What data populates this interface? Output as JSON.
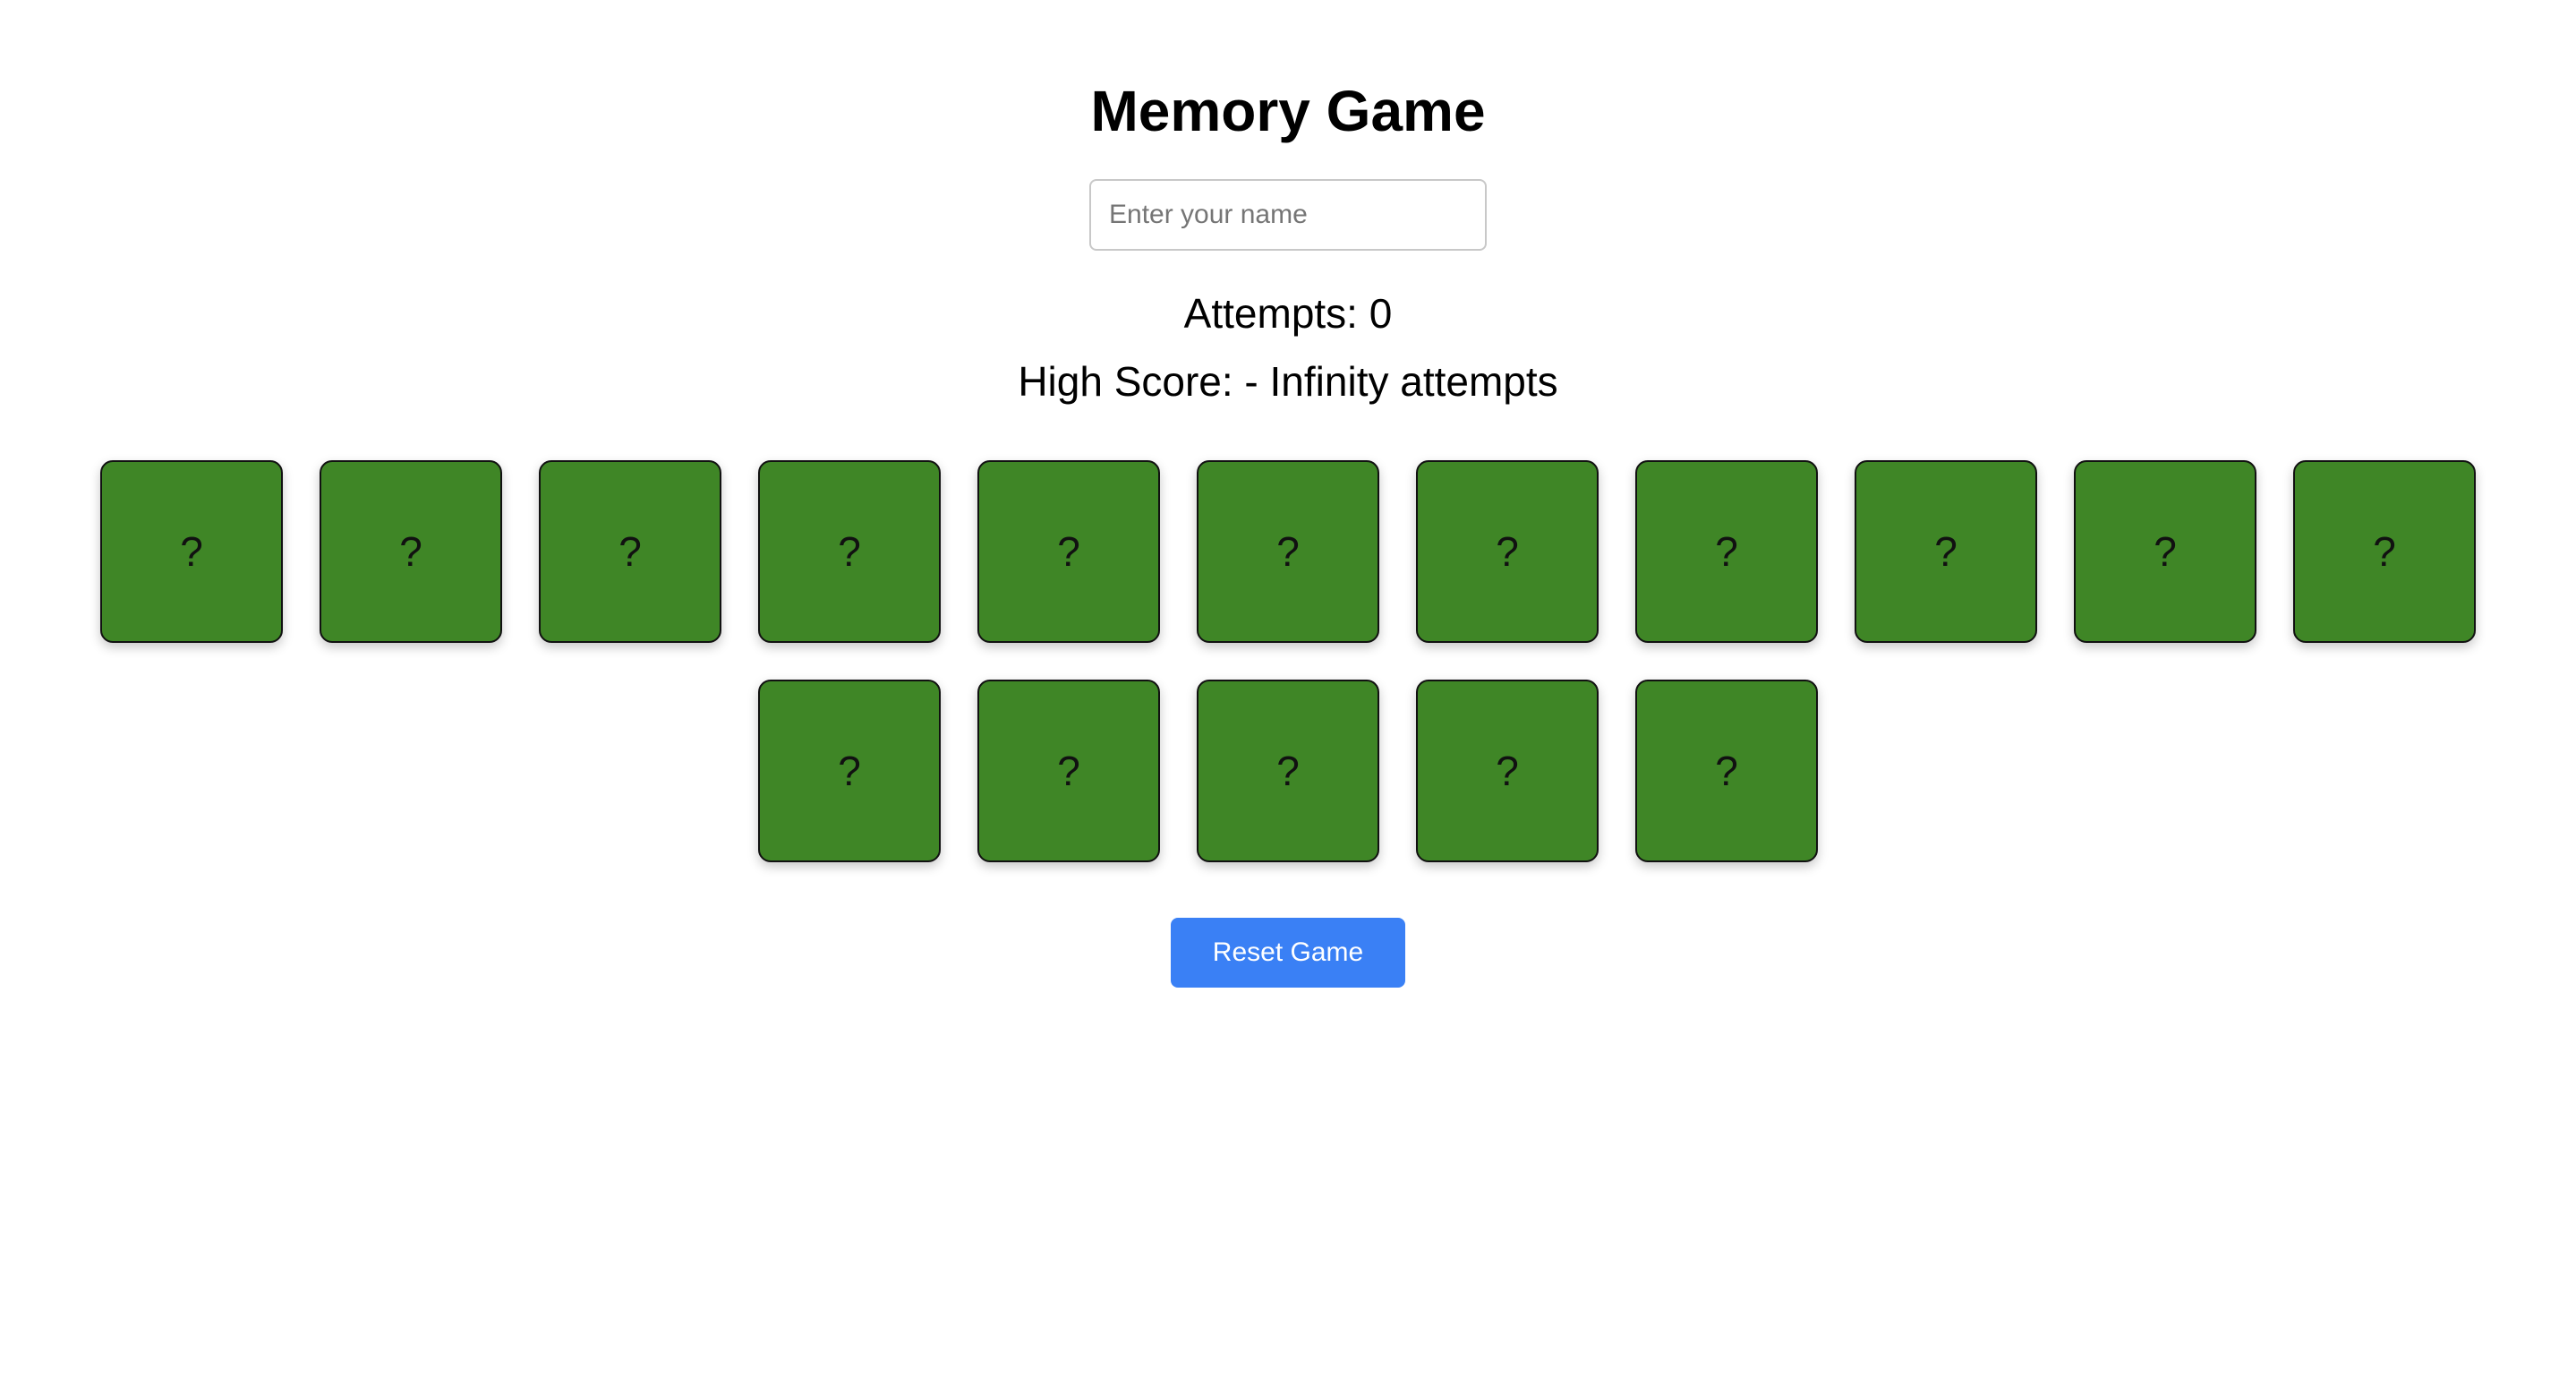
{
  "header": {
    "title": "Memory Game"
  },
  "name_input": {
    "placeholder": "Enter your name",
    "value": ""
  },
  "stats": {
    "attempts_text": "Attempts: 0",
    "high_score_text": "High Score: - Infinity attempts"
  },
  "board": {
    "card_color": "#3f8626",
    "cards": [
      {
        "face": "?"
      },
      {
        "face": "?"
      },
      {
        "face": "?"
      },
      {
        "face": "?"
      },
      {
        "face": "?"
      },
      {
        "face": "?"
      },
      {
        "face": "?"
      },
      {
        "face": "?"
      },
      {
        "face": "?"
      },
      {
        "face": "?"
      },
      {
        "face": "?"
      },
      {
        "face": "?"
      },
      {
        "face": "?"
      },
      {
        "face": "?"
      },
      {
        "face": "?"
      },
      {
        "face": "?"
      }
    ]
  },
  "controls": {
    "reset_label": "Reset Game",
    "reset_color": "#3a80f5"
  }
}
